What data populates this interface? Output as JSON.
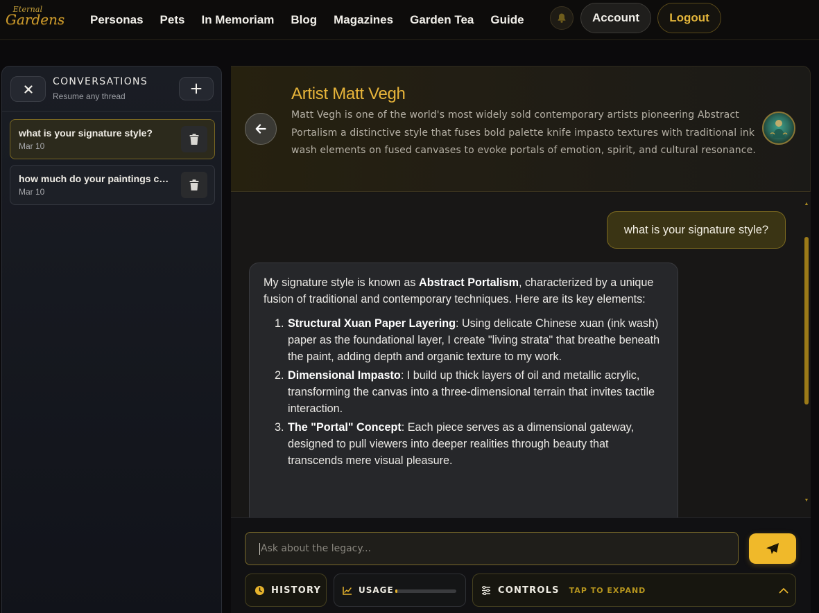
{
  "brand": {
    "line1": "Eternal",
    "line2": "Gardens"
  },
  "nav": {
    "links": [
      "Personas",
      "Pets",
      "In Memoriam",
      "Blog",
      "Magazines",
      "Garden Tea",
      "Guide"
    ],
    "account_label": "Account",
    "logout_label": "Logout"
  },
  "sidebar": {
    "title": "CONVERSATIONS",
    "subtitle": "Resume any thread",
    "conversations": [
      {
        "title": "what is your signature style?",
        "date": "Mar 10",
        "active": true
      },
      {
        "title": "how much do your paintings cost?",
        "date": "Mar 10",
        "active": false
      }
    ]
  },
  "persona": {
    "name": "Artist Matt Vegh",
    "description": "Matt Vegh is one of the world's most widely sold contemporary artists pioneering Abstract Portalism a distinctive style that fuses bold palette knife impasto textures with traditional ink wash elements on fused canvases to evoke portals of emotion, spirit, and cultural resonance."
  },
  "chat": {
    "user_message": "what is your signature style?",
    "bot_intro_before": "My signature style is known as ",
    "bot_intro_bold": "Abstract Portalism",
    "bot_intro_after": ", characterized by a unique fusion of traditional and contemporary techniques. Here are its key elements:",
    "bot_points": [
      {
        "bold": "Structural Xuan Paper Layering",
        "text": ": Using delicate Chinese xuan (ink wash) paper as the foundational layer, I create \"living strata\" that breathe beneath the paint, adding depth and organic texture to my work."
      },
      {
        "bold": "Dimensional Impasto",
        "text": ": I build up thick layers of oil and metallic acrylic, transforming the canvas into a three-dimensional terrain that invites tactile interaction."
      },
      {
        "bold": "The \"Portal\" Concept",
        "text": ": Each piece serves as a dimensional gateway, designed to pull viewers into deeper realities through beauty that transcends mere visual pleasure."
      }
    ]
  },
  "composer": {
    "placeholder": "Ask about the legacy...",
    "history_label": "HISTORY",
    "usage_label": "USAGE",
    "usage_fraction": 0.03,
    "controls_label": "CONTROLS",
    "controls_hint": "TAP TO EXPAND"
  },
  "colors": {
    "accent": "#f0b92a",
    "accent_text": "#e8b53a",
    "background": "#0b0a0c"
  }
}
